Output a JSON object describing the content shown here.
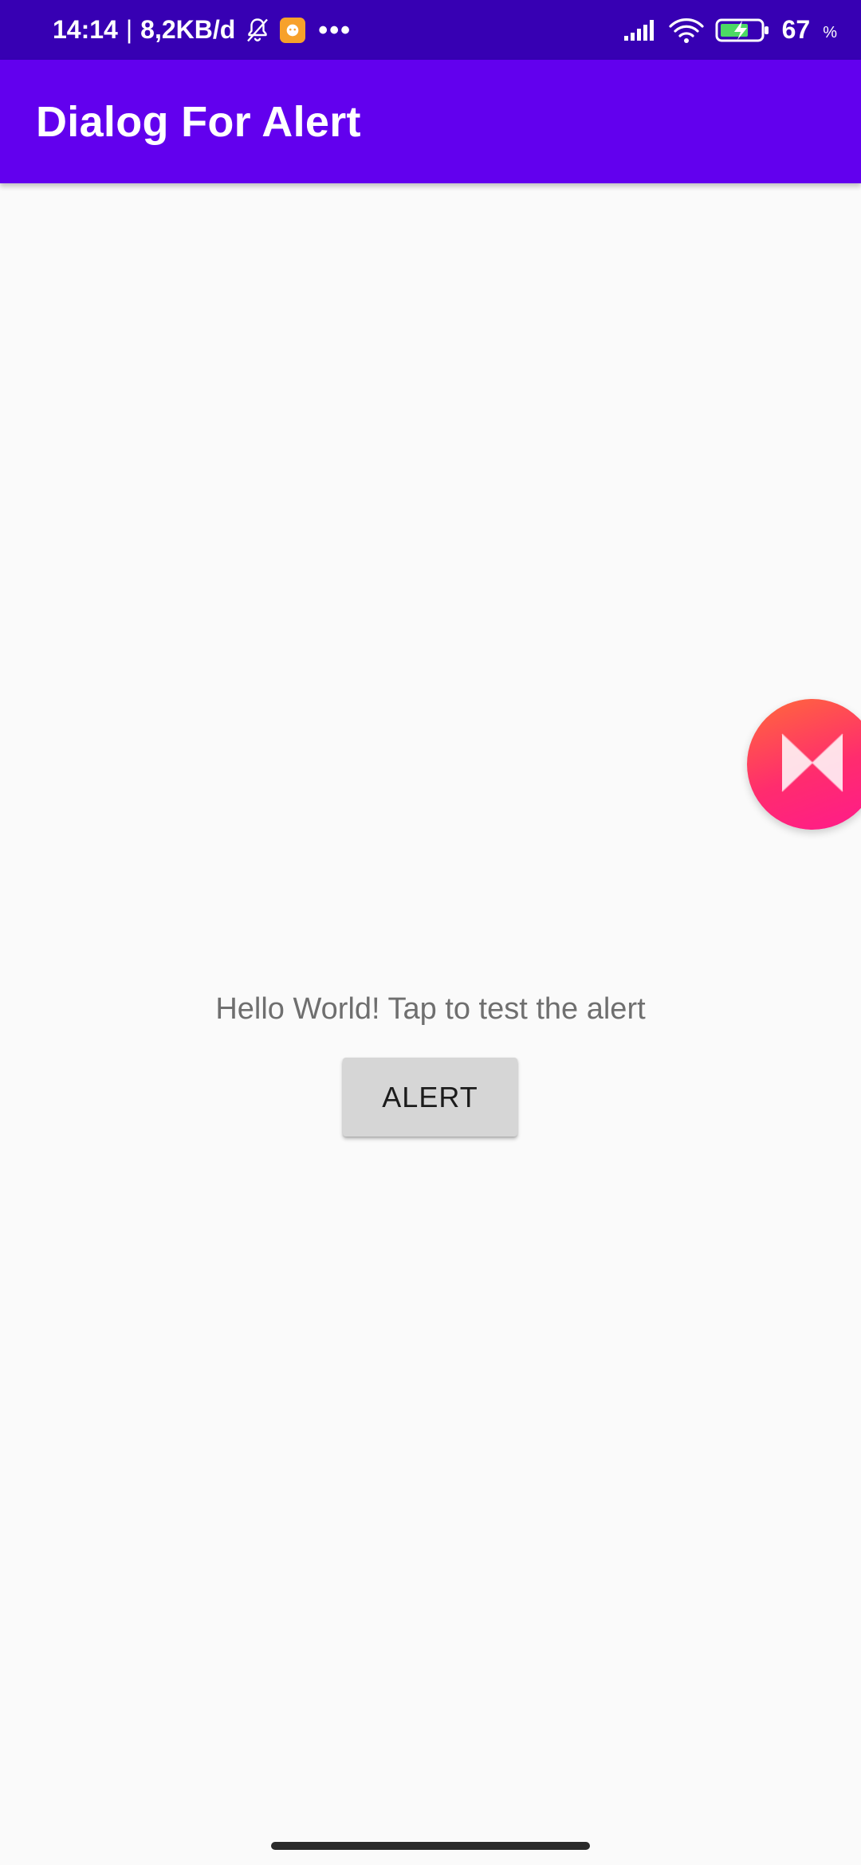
{
  "status_bar": {
    "time": "14:14",
    "separator": "|",
    "network_speed": "8,2KB/d",
    "overflow_dots": "•••",
    "battery_percent": "67",
    "percent_sign": "%",
    "icons": [
      "bell-off-icon",
      "app-notification-icon",
      "signal-icon",
      "wifi-icon",
      "battery-charging-icon"
    ]
  },
  "app_bar": {
    "title": "Dialog For Alert",
    "color": "#6200ee"
  },
  "main": {
    "message": "Hello World! Tap to test the alert",
    "alert_button_label": "ALERT"
  },
  "floating_bubble": {
    "icon": "music-player-bubble-icon"
  },
  "colors": {
    "status_bar": "#3700b3",
    "app_bar": "#6200ee",
    "background": "#fafafa",
    "button": "#d6d6d6"
  }
}
